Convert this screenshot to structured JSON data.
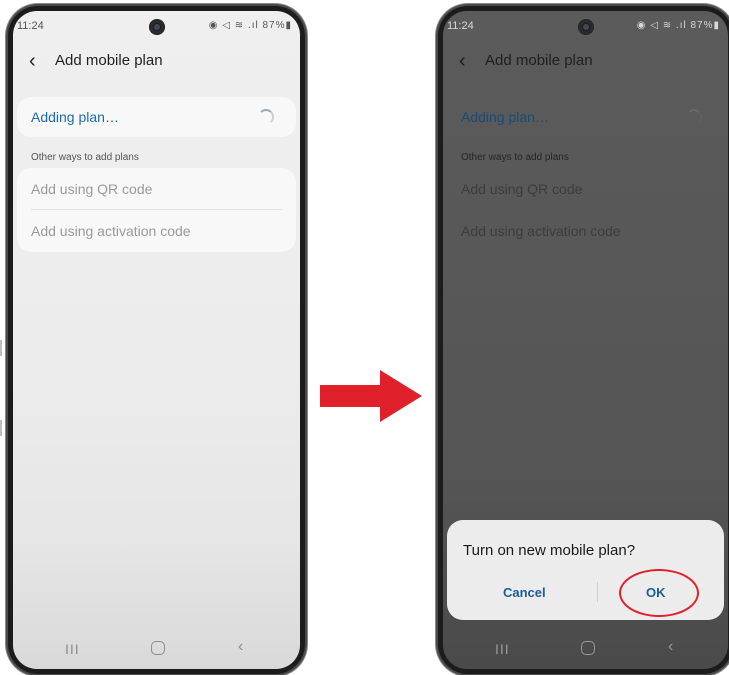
{
  "colors": {
    "accent_blue": "#1c6bb5",
    "dialog_button_blue": "#1c5c97",
    "arrow_red": "#e0202a",
    "highlight_red": "#e0202a"
  },
  "left_screen": {
    "status": {
      "time": "11:24",
      "icons_text": "◉ ◁ ≋ .ıl 87%▮"
    },
    "app_bar": {
      "back_icon": "‹",
      "title": "Add mobile plan"
    },
    "adding_row": {
      "label": "Adding plan…"
    },
    "section_header": "Other ways to add plans",
    "options": [
      {
        "label": "Add using QR code"
      },
      {
        "label": "Add using activation code"
      }
    ],
    "nav": {
      "recents_glyph": "III",
      "back_glyph": "‹"
    }
  },
  "right_screen": {
    "status": {
      "time": "11:24",
      "icons_text": "◉ ◁ ≋ .ıl 87%▮"
    },
    "app_bar": {
      "back_icon": "‹",
      "title": "Add mobile plan"
    },
    "adding_row": {
      "label": "Adding plan…"
    },
    "section_header": "Other ways to add plans",
    "options": [
      {
        "label": "Add using QR code"
      },
      {
        "label": "Add using activation code"
      }
    ],
    "dialog": {
      "title": "Turn on new mobile plan?",
      "cancel_label": "Cancel",
      "ok_label": "OK"
    },
    "nav": {
      "recents_glyph": "III",
      "back_glyph": "‹"
    }
  },
  "icons": {
    "transition_arrow": "arrow-right-icon",
    "back": "chevron-left-icon",
    "spinner": "loading-spinner-icon"
  }
}
